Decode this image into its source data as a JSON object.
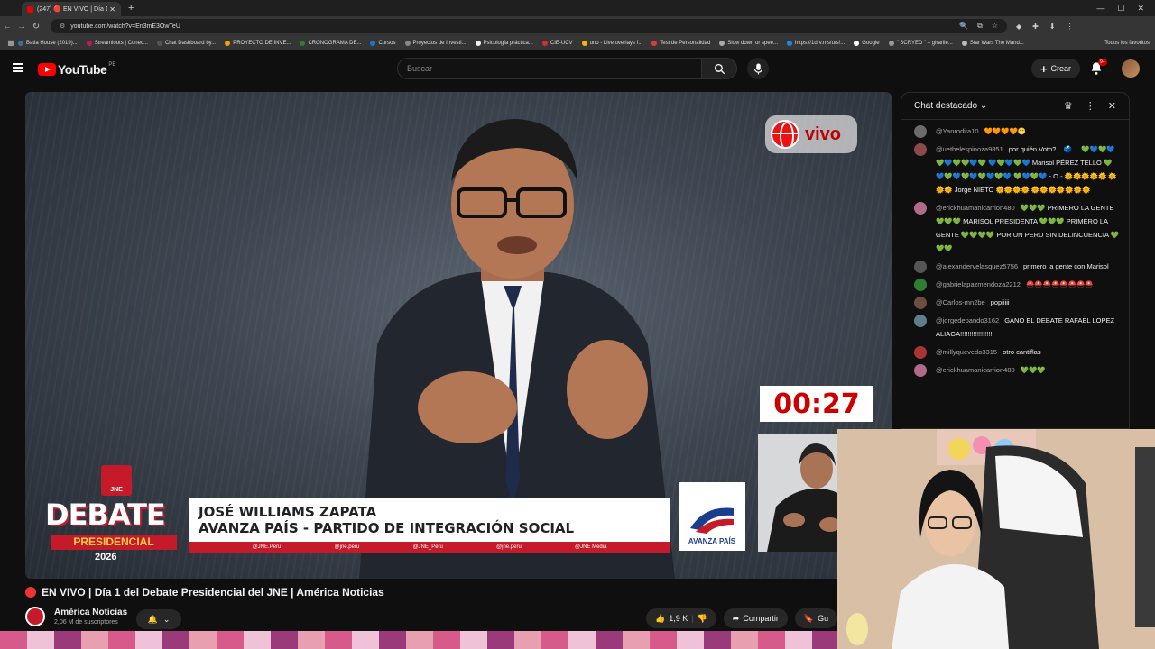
{
  "browser": {
    "tab_title": "(247) 🔴 EN VIVO | Día 1 d",
    "url": "youtube.com/watch?v=En3mE3OwTeU",
    "bookmarks": [
      "Batla House (2019)...",
      "Streamloots | Conec...",
      "Chat Dashboard by...",
      "PROYECTO DE INVE...",
      "CRONOGRAMA DE...",
      "Cursos",
      "Proyectos de Investi...",
      "Psicología práctica...",
      "CIE-UCV",
      "uno - Live overlays f...",
      "Test de Personalidad",
      "Slow down or spee...",
      "https://1drv.ms/u/s!...",
      "Google",
      "\" SCRYED \" – gharlie...",
      "Star Wars The Mand..."
    ],
    "bookmarks_all": "Todos los favoritos"
  },
  "yt": {
    "logo": "YouTube",
    "country": "PE",
    "search_placeholder": "Buscar",
    "create_label": "Crear",
    "notif_count": "9+"
  },
  "video": {
    "live_badge": "vivo",
    "timer": "00:27",
    "jne_badge": "JNE",
    "debate_word": "DEBATE",
    "presidencial": "PRESIDENCIAL",
    "year": "2026",
    "candidate_name": "JOSÉ WILLIAMS ZAPATA",
    "candidate_party": "AVANZA PAÍS - PARTIDO DE INTEGRACIÓN SOCIAL",
    "socials": [
      "@JNE.Peru",
      "@jne.peru",
      "@JNE_Peru",
      "@jne.peru",
      "@JNE Media"
    ],
    "party_logo_text": "AVANZA PAÍS"
  },
  "meta": {
    "title": "EN VIVO | Día 1 del Debate Presidencial del JNE | América Noticias",
    "channel": "América Noticias",
    "subs": "2,06 M de suscriptores",
    "likes": "1,9 K",
    "share": "Compartir",
    "save": "Gu"
  },
  "chat": {
    "title": "Chat destacado",
    "messages": [
      {
        "author": "@Yanrodita10",
        "text": "🧡🧡🧡🧡😁",
        "color": "#6b6b6b"
      },
      {
        "author": "@uethelespinoza9851",
        "text": "por quién Voto? ...🗳️ ... 💚💙💚💙💚💙💚💚💙💚 💙💚💙💚💙 Marisol PÉREZ TELLO 💚💙💚💙💚💙💚💙💚💙 💚💙💚💙 - O - 🌞🌞🌞🌞🌞 🌞🌞🌞 Jorge NIETO 🌞🌞🌞🌞 🌞🌞🌞🌞🌞🌞🌞",
        "color": "#8a4a4a"
      },
      {
        "author": "@erickhuamanicarrion480",
        "text": "💚💚💚 PRIMERO LA GENTE 💚💚💚 MARISOL PRESIDENTA 💚💚💚 PRIMERO LA GENTE 💚💚💚💚 POR UN PERU SIN DELINCUENCIA 💚💚💚",
        "color": "#b06a8a"
      },
      {
        "author": "@alexandervelasquez5756",
        "text": "primero la gente con Marisol",
        "color": "#555"
      },
      {
        "author": "@gabrielapazmendoza2212",
        "text": "⛑️⛑️⛑️⛑️⛑️⛑️⛑️⛑️",
        "color": "#2e7d32"
      },
      {
        "author": "@Carlos-mn2be",
        "text": "popiiiii",
        "color": "#6d4c41"
      },
      {
        "author": "@jorgedepando3162",
        "text": "GANO EL DEBATE RAFAEL LOPEZ ALIAGA!!!!!!!!!!!!!!!!!",
        "color": "#607d8b"
      },
      {
        "author": "@millyquevedo3315",
        "text": "otro cantiflas",
        "color": "#a33"
      },
      {
        "author": "@erickhuamanicarrion480",
        "text": "💚💚💚",
        "color": "#b06a8a"
      }
    ]
  }
}
